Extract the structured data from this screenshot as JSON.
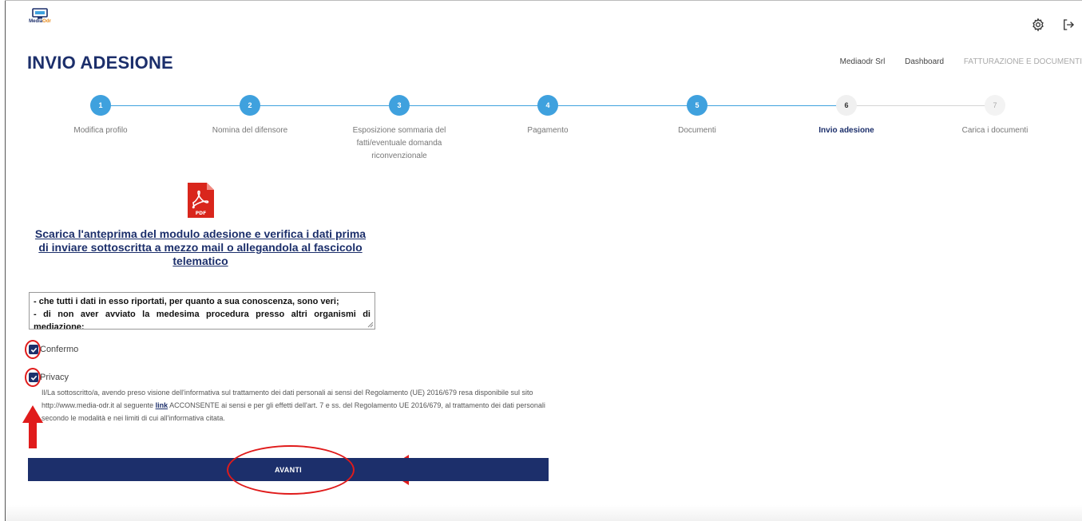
{
  "app": {
    "logo_primary": "Media",
    "logo_accent": "Odr"
  },
  "header": {
    "title": "INVIO ADESIONE"
  },
  "breadcrumb": [
    "Mediaodr Srl",
    "Dashboard",
    "FATTURAZIONE E DOCUMENTI"
  ],
  "steps": [
    {
      "number": "1",
      "label": "Modifica profilo",
      "state": "done"
    },
    {
      "number": "2",
      "label": "Nomina del difensore",
      "state": "done"
    },
    {
      "number": "3",
      "label": "Esposizione sommaria del fatti/eventuale domanda riconvenzionale",
      "state": "done"
    },
    {
      "number": "4",
      "label": "Pagamento",
      "state": "done"
    },
    {
      "number": "5",
      "label": "Documenti",
      "state": "done"
    },
    {
      "number": "6",
      "label": "Invio adesione",
      "state": "current"
    },
    {
      "number": "7",
      "label": "Carica i documenti",
      "state": "future"
    }
  ],
  "pdf": {
    "icon_label": "PDF",
    "link_text": "Scarica l'anteprima del modulo adesione e verifica i dati prima di inviare sottoscritta a mezzo mail o allegandola al fascicolo telematico"
  },
  "declaration": {
    "lines": [
      "- che tutti i dati in esso riportati, per quanto a sua conoscenza, sono veri;",
      "- di non aver avviato la medesima procedura presso altri organismi di mediazione;"
    ]
  },
  "checkboxes": {
    "confermo": {
      "label": "Confermo",
      "checked": true
    },
    "privacy": {
      "label": "Privacy",
      "checked": true
    }
  },
  "privacy_text": {
    "before_link": "Il/La sottoscritto/a, avendo preso visione dell'informativa sul trattamento dei dati personali ai sensi del Regolamento (UE) 2016/679 resa disponibile sul sito http://www.media-odr.it al seguente",
    "link": "link",
    "after_link": "ACCONSENTE ai sensi e per gli effetti dell'art. 7 e ss. del Regolamento UE 2016/679, al trattamento dei dati personali secondo le modalità e nei limiti di cui all'informativa citata."
  },
  "actions": {
    "next_label": "AVANTI"
  },
  "colors": {
    "brand_navy": "#1c2f6b",
    "step_blue": "#3fa1de",
    "annotation_red": "#e01b1b",
    "logo_orange": "#e88a1a"
  },
  "icons": {
    "settings": "gear-icon",
    "logout": "logout-icon",
    "pdf": "pdf-file-icon"
  }
}
